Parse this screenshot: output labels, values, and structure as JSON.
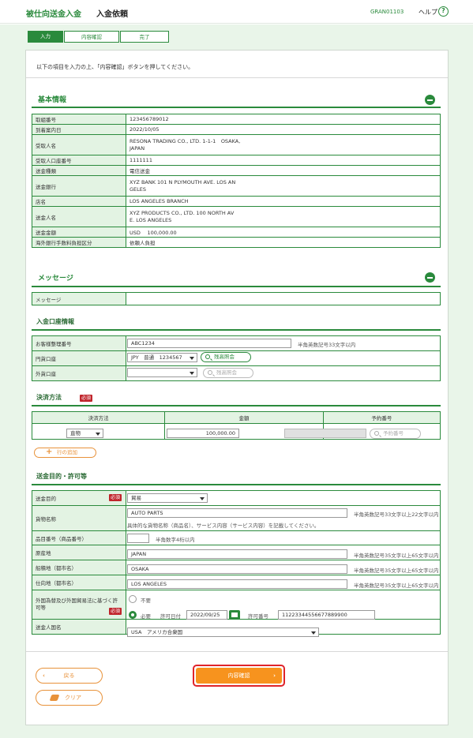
{
  "header": {
    "title": "被仕向送金入金",
    "subtitle": "入金依頼",
    "code": "GRAN01103",
    "help": "ヘルプ"
  },
  "steps": [
    "入力",
    "内容確認",
    "完了"
  ],
  "intro": "以下の項目を入力の上、「内容確認」ボタンを押してください。",
  "basic": {
    "title": "基本情報",
    "rows": [
      {
        "label": "取組番号",
        "value": "123456789012"
      },
      {
        "label": "到着案内日",
        "value": "2022/10/05"
      },
      {
        "label": "受取人名",
        "value": "RESONA TRADING CO., LTD. 1-1-1　OSAKA,\nJAPAN"
      },
      {
        "label": "受取人口座番号",
        "value": "1111111"
      },
      {
        "label": "送金種類",
        "value": "電信送金"
      },
      {
        "label": "送金銀行",
        "value": "XYZ BANK 101 N PLYMOUTH AVE. LOS AN\nGELES"
      },
      {
        "label": "店名",
        "value": "LOS ANGELES BRANCH"
      },
      {
        "label": "送金人名",
        "value": "XYZ PRODUCTS CO., LTD. 100 NORTH AV\nE. LOS ANGELES"
      },
      {
        "label": "送金金額",
        "value": "USD　 100,000.00"
      },
      {
        "label": "海外銀行手数料負担区分",
        "value": "依頼人負担"
      }
    ]
  },
  "message": {
    "title": "メッセージ",
    "label": "メッセージ",
    "value": ""
  },
  "account": {
    "title": "入金口座情報",
    "ref_label": "お客様整理番号",
    "ref_value": "ABC1234",
    "ref_note": "半角英数記号33文字以内",
    "yen_label": "円貨口座",
    "yen_value": "JPY　普通　1234567",
    "balance_btn": "残高照会",
    "fx_label": "外貨口座",
    "fx_value": "",
    "balance_btn2": "残高照会"
  },
  "settlement": {
    "title": "決済方法",
    "required": "必須",
    "headers": [
      "決済方法",
      "金額",
      "予約番号"
    ],
    "method": "直物",
    "amount": "100,000.00",
    "rate_no": "",
    "rate_btn": "予約番号",
    "add_row": "行の追加"
  },
  "purpose": {
    "title": "送金目的・許可等",
    "purpose_label": "送金目的",
    "purpose_value": "貿易",
    "required": "必須",
    "goods_label": "貨物名称",
    "goods_value": "AUTO PARTS",
    "goods_note": "半角英数記号33文字以上22文字以内",
    "goods_note2": "具体的な貨物名称（商品名）、サービス内容（サービス内容）を記載してください。",
    "hs_label": "品目番号（商品番号）",
    "hs_value": "",
    "hs_note": "半角数字4桁以内",
    "origin_label": "原産地",
    "origin_value": "JAPAN",
    "origin_note": "半角英数記号35文字以上65文字以内",
    "ship_label": "船積地（都市名）",
    "ship_value": "OSAKA",
    "ship_note": "半角英数記号35文字以上65文字以内",
    "dest_label": "仕向地（都市名）",
    "dest_value": "LOS ANGELES",
    "dest_note": "半角英数記号35文字以上65文字以内",
    "permit_label": "外国為替及び外国貿易法に基づく許可等",
    "permit_req": "必須",
    "permit_none": "不要",
    "permit_yes": "必要",
    "permit_date_label": "許可日付",
    "permit_date": "2022/09/25",
    "permit_no_label": "許可番号",
    "permit_no": "11223344556677889900",
    "country_label": "送金人国名",
    "country_value": "USA　アメリカ合衆国"
  },
  "buttons": {
    "back": "戻る",
    "confirm": "内容確認",
    "clear": "クリア"
  },
  "colors": {
    "accent": "#2a8a3c",
    "orange": "#f7931e",
    "required": "#c0242b"
  }
}
